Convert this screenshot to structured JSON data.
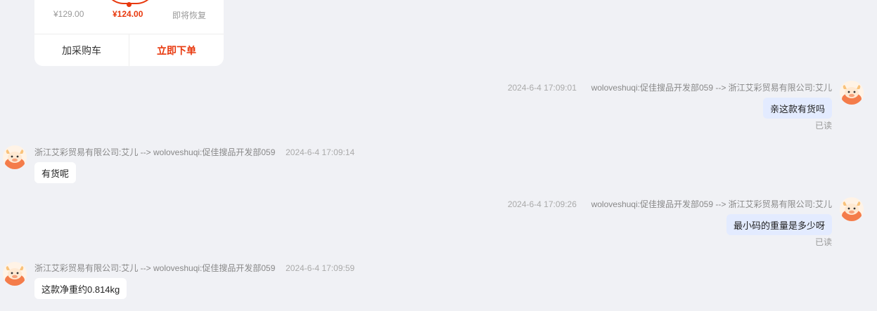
{
  "product_card": {
    "original_price": "¥129.00",
    "current_price": "¥124.00",
    "restore_label": "即将恢复",
    "add_to_cart": "加采购车",
    "buy_now": "立即下单",
    "accent_color": "#e8380d"
  },
  "messages": [
    {
      "direction": "outgoing",
      "time": "2024-6-4 17:09:01",
      "route": "woloveshuqi:促佳搜品开发部059 --> 浙江艾彩贸易有限公司:艾儿",
      "text": "亲这款有货吗",
      "status": "已读"
    },
    {
      "direction": "incoming",
      "route": "浙江艾彩贸易有限公司:艾儿 --> woloveshuqi:促佳搜品开发部059",
      "time": "2024-6-4 17:09:14",
      "text": "有货呢"
    },
    {
      "direction": "outgoing",
      "time": "2024-6-4 17:09:26",
      "route": "woloveshuqi:促佳搜品开发部059 --> 浙江艾彩贸易有限公司:艾儿",
      "text": "最小码的重量是多少呀",
      "status": "已读"
    },
    {
      "direction": "incoming",
      "route": "浙江艾彩贸易有限公司:艾儿 --> woloveshuqi:促佳搜品开发部059",
      "time": "2024-6-4 17:09:59",
      "text": "这款净重约0.814kg"
    }
  ],
  "colors": {
    "background": "#f0f1f5",
    "outgoing_bubble": "#e3ebff",
    "incoming_bubble": "#ffffff",
    "avatar_face": "#f47c4a"
  },
  "icons": {
    "avatar": "cow-mascot-icon"
  }
}
